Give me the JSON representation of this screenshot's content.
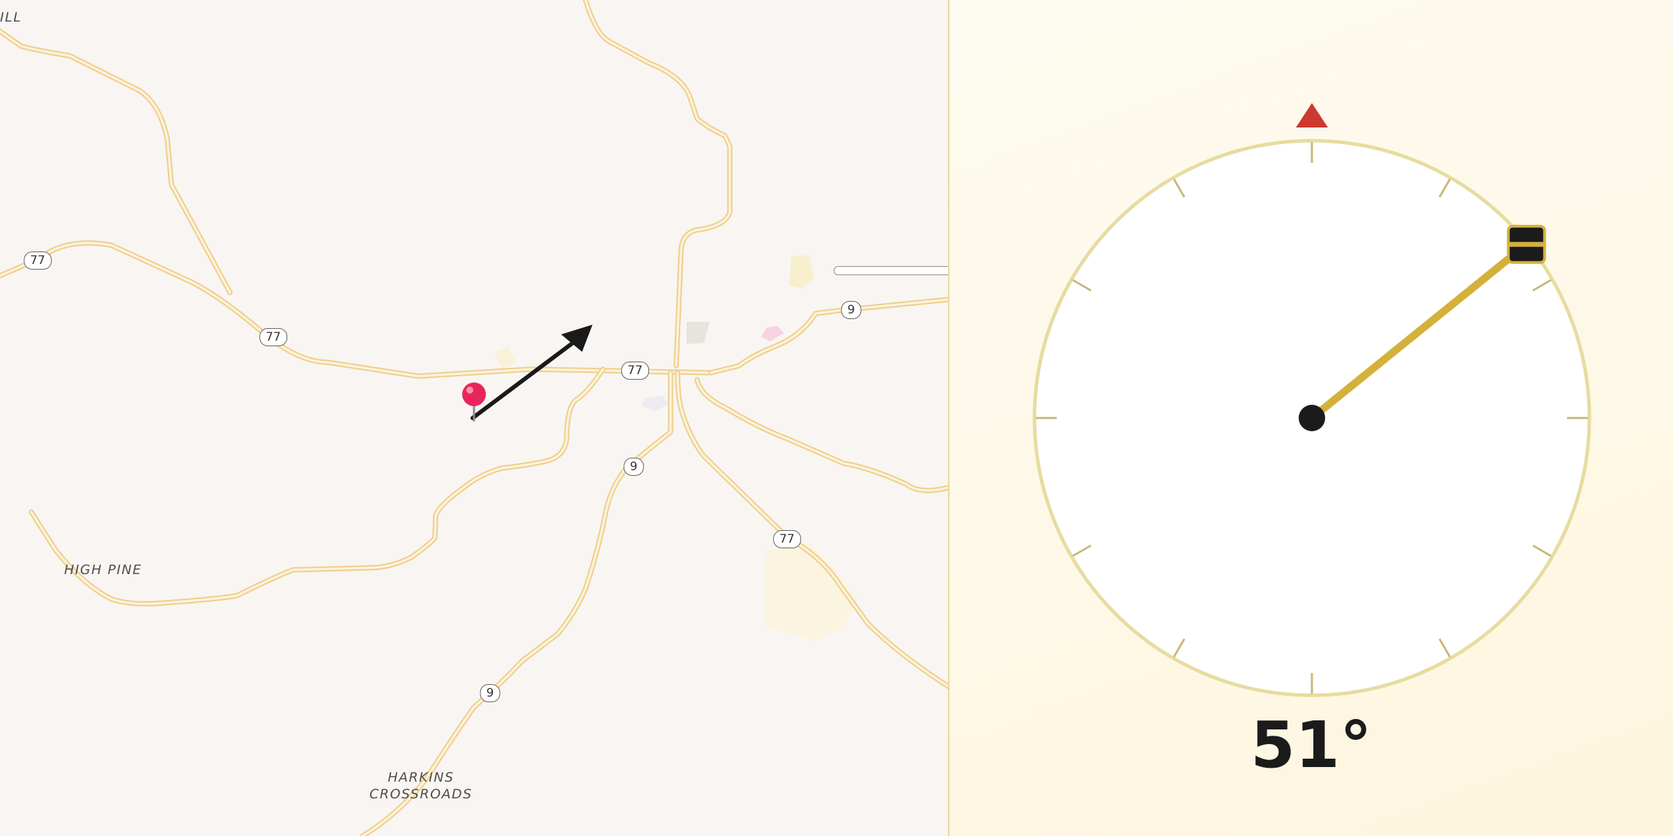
{
  "map": {
    "place_labels": [
      {
        "id": "partial-top-left",
        "text": "ILL"
      },
      {
        "id": "high-pine",
        "text": "HIGH PINE"
      },
      {
        "id": "harkins-crossroads",
        "text": "HARKINS\nCROSSROADS"
      }
    ],
    "route_shields": [
      "77",
      "77",
      "77",
      "77",
      "9",
      "9",
      "9"
    ],
    "pin_color": "#e8265d",
    "road_color": "#eed08f",
    "arrow_color": "#1a1a1a"
  },
  "compass": {
    "heading_deg": 51,
    "heading_text": "51°",
    "north_marker_color": "#cc3a2f",
    "needle_color": "#d4b13a",
    "ring_color": "#e7dca0"
  }
}
